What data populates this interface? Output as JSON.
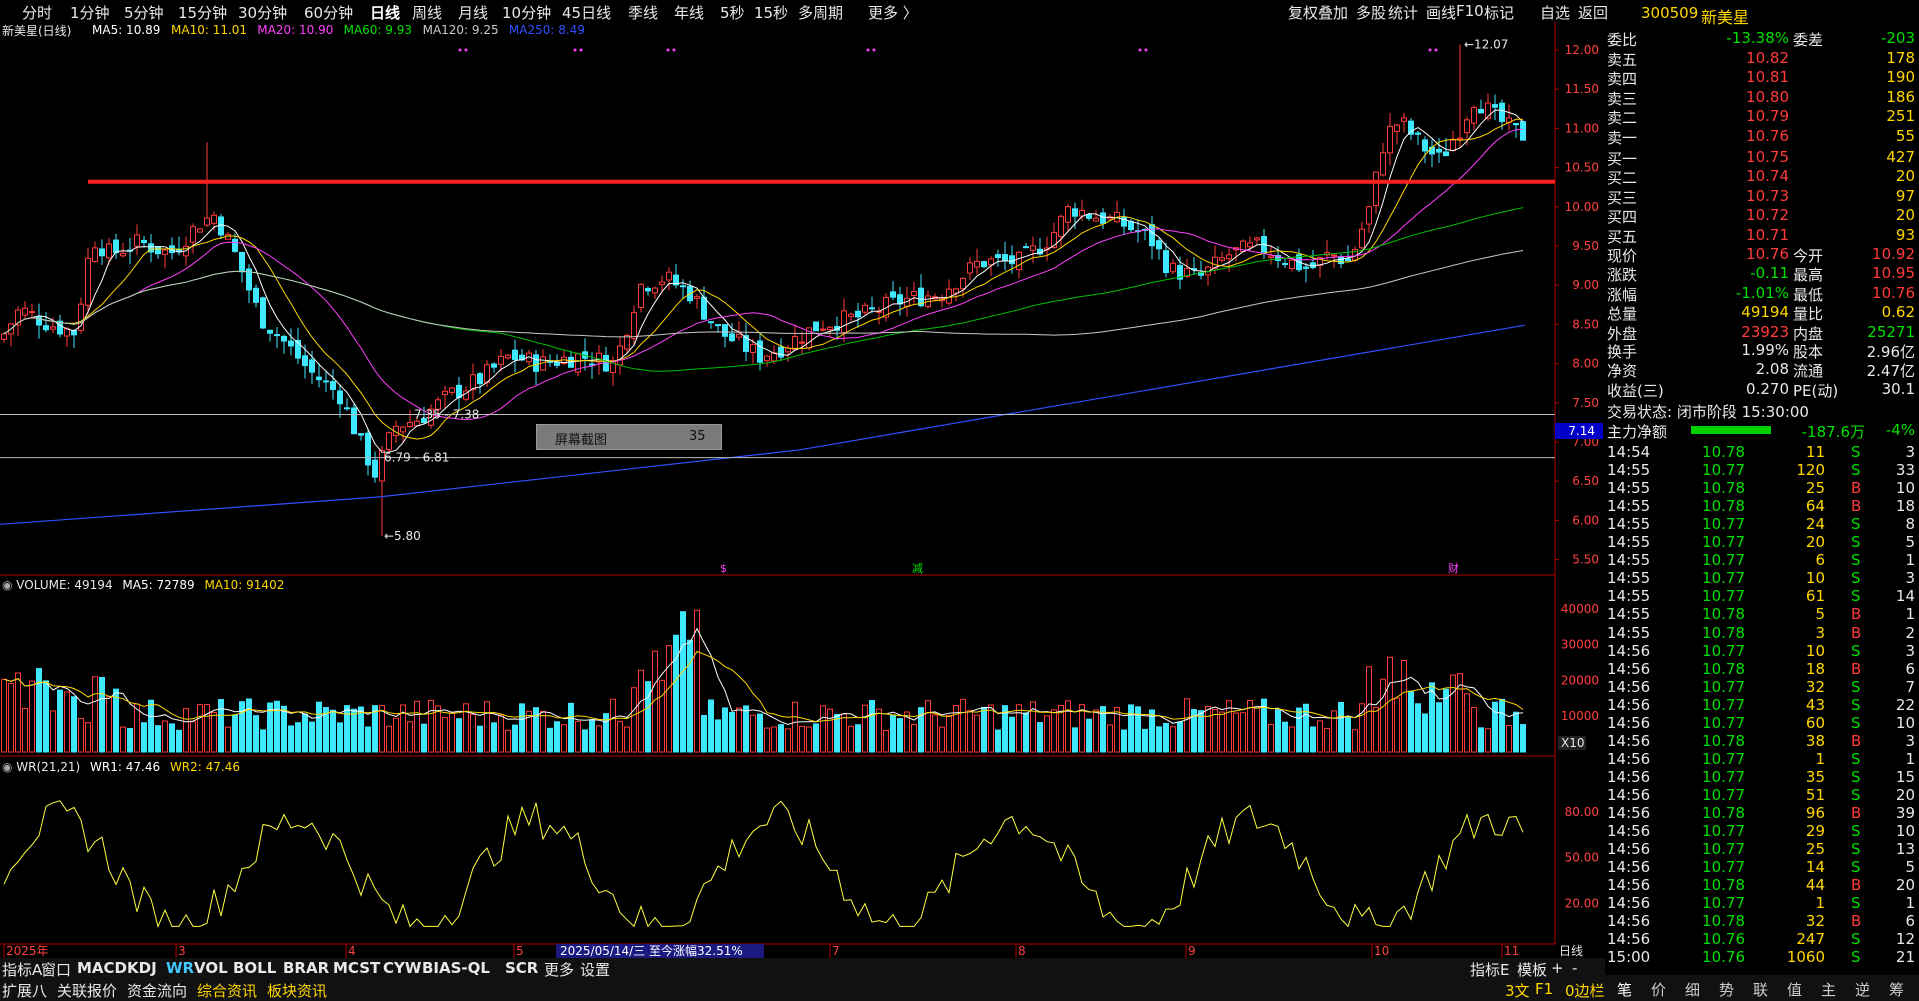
{
  "toolbar": {
    "periods": [
      "分时",
      "1分钟",
      "5分钟",
      "15分钟",
      "30分钟",
      "60分钟",
      "日线",
      "周线",
      "月线",
      "10分钟",
      "45日线",
      "季线",
      "年线",
      "5秒",
      "15秒",
      "多周期",
      "更多 〉"
    ],
    "active_period": "日线",
    "right_items": [
      "复权",
      "叠加",
      "多股",
      "统计",
      "画线",
      "F10",
      "标记",
      "自选",
      "返回"
    ]
  },
  "kline": {
    "title": "新美星(日线)",
    "ma_labels": [
      {
        "text": "MA5: 10.89",
        "color": "#ffffff"
      },
      {
        "text": "MA10: 11.01",
        "color": "#ffd700"
      },
      {
        "text": "MA20: 10.90",
        "color": "#ff40ff"
      },
      {
        "text": "MA60: 9.93",
        "color": "#00e000"
      },
      {
        "text": "MA120: 9.25",
        "color": "#c8c8c8"
      },
      {
        "text": "MA250: 8.49",
        "color": "#3050ff"
      }
    ],
    "y_ticks": [
      "12.00",
      "11.50",
      "11.00",
      "10.50",
      "10.00",
      "9.50",
      "9.00",
      "8.50",
      "8.00",
      "7.50",
      "7.00",
      "6.50",
      "6.00",
      "5.50"
    ],
    "high_label": "12.07",
    "low_label": "5.80",
    "annotation1": "6.79 - 6.81",
    "annotation2": "7.35 - 7.38",
    "current_price_tag": "7.14",
    "screenshot_popup": {
      "label": "屏幕截图",
      "value": "35"
    },
    "markers": [
      "$",
      "减",
      "财"
    ]
  },
  "volume": {
    "title": "VOLUME: 49194",
    "ma5": "MA5: 72789",
    "ma10": "MA10: 91402",
    "y_ticks": [
      "40000",
      "30000",
      "20000",
      "10000"
    ],
    "unit": "X10"
  },
  "wr": {
    "title": "WR(21,21)",
    "wr1": "WR1: 47.46",
    "wr2": "WR2: 47.46",
    "y_ticks": [
      "80.00",
      "50.00",
      "20.00"
    ]
  },
  "xaxis": {
    "labels": [
      "2025年",
      "3",
      "4",
      "5",
      "7",
      "8",
      "9",
      "10",
      "11"
    ],
    "range_text": "2025/05/14/三  至今涨幅32.51%",
    "period_label": "日线"
  },
  "bottom_tabs1": [
    "指标A",
    "窗口",
    "MACD",
    "KDJ",
    "WR",
    "VOL",
    "BOLL",
    "BRAR",
    "MCST",
    "CYW",
    "BIAS-QL",
    "SCR",
    "更多",
    "设置"
  ],
  "bottom_tabs2": [
    "扩展八",
    "关联报价",
    "资金流向",
    "综合资讯",
    "板块资讯"
  ],
  "bottom_right1": [
    "指标E",
    "模板",
    "+",
    "-"
  ],
  "bottom_right2": [
    "3文",
    "F1",
    "0边栏"
  ],
  "quote": {
    "code": "300509",
    "name": "新美星",
    "weibi_label": "委比",
    "weibi": "-13.38%",
    "weicha_label": "委差",
    "weicha": "-203",
    "asks": [
      {
        "label": "卖五",
        "price": "10.82",
        "vol": "178"
      },
      {
        "label": "卖四",
        "price": "10.81",
        "vol": "190"
      },
      {
        "label": "卖三",
        "price": "10.80",
        "vol": "186"
      },
      {
        "label": "卖二",
        "price": "10.79",
        "vol": "251"
      },
      {
        "label": "卖一",
        "price": "10.76",
        "vol": "55"
      }
    ],
    "bids": [
      {
        "label": "买一",
        "price": "10.75",
        "vol": "427"
      },
      {
        "label": "买二",
        "price": "10.74",
        "vol": "20"
      },
      {
        "label": "买三",
        "price": "10.73",
        "vol": "97"
      },
      {
        "label": "买四",
        "price": "10.72",
        "vol": "20"
      },
      {
        "label": "买五",
        "price": "10.71",
        "vol": "93"
      }
    ],
    "stats": [
      {
        "l1": "现价",
        "v1": "10.76",
        "c1": "red",
        "l2": "今开",
        "v2": "10.92",
        "c2": "red"
      },
      {
        "l1": "涨跌",
        "v1": "-0.11",
        "c1": "grn",
        "l2": "最高",
        "v2": "10.95",
        "c2": "red"
      },
      {
        "l1": "涨幅",
        "v1": "-1.01%",
        "c1": "grn",
        "l2": "最低",
        "v2": "10.76",
        "c2": "red"
      },
      {
        "l1": "总量",
        "v1": "49194",
        "c1": "yel",
        "l2": "量比",
        "v2": "0.62",
        "c2": "yel"
      },
      {
        "l1": "外盘",
        "v1": "23923",
        "c1": "red",
        "l2": "内盘",
        "v2": "25271",
        "c2": "grn"
      }
    ],
    "stats2": [
      {
        "l1": "换手",
        "v1": "1.99%",
        "l2": "股本",
        "v2": "2.96亿"
      },
      {
        "l1": "净资",
        "v1": "2.08",
        "l2": "流通",
        "v2": "2.47亿"
      },
      {
        "l1": "收益(三)",
        "v1": "0.270",
        "l2": "PE(动)",
        "v2": "30.1"
      }
    ],
    "trade_status": "交易状态: 闭市阶段 15:30:00",
    "main_flow_label": "主力净额",
    "main_flow_value": "-187.6万",
    "main_flow_pct": "-4%"
  },
  "ticks": [
    {
      "t": "14:54",
      "p": "10.78",
      "v": "11",
      "s": "S",
      "n": "3"
    },
    {
      "t": "14:55",
      "p": "10.77",
      "v": "120",
      "s": "S",
      "n": "33"
    },
    {
      "t": "14:55",
      "p": "10.78",
      "v": "25",
      "s": "B",
      "n": "10"
    },
    {
      "t": "14:55",
      "p": "10.78",
      "v": "64",
      "s": "B",
      "n": "18"
    },
    {
      "t": "14:55",
      "p": "10.77",
      "v": "24",
      "s": "S",
      "n": "8"
    },
    {
      "t": "14:55",
      "p": "10.77",
      "v": "20",
      "s": "S",
      "n": "5"
    },
    {
      "t": "14:55",
      "p": "10.77",
      "v": "6",
      "s": "S",
      "n": "1"
    },
    {
      "t": "14:55",
      "p": "10.77",
      "v": "10",
      "s": "S",
      "n": "3"
    },
    {
      "t": "14:55",
      "p": "10.77",
      "v": "61",
      "s": "S",
      "n": "14"
    },
    {
      "t": "14:55",
      "p": "10.78",
      "v": "5",
      "s": "B",
      "n": "1"
    },
    {
      "t": "14:55",
      "p": "10.78",
      "v": "3",
      "s": "B",
      "n": "2"
    },
    {
      "t": "14:56",
      "p": "10.77",
      "v": "10",
      "s": "S",
      "n": "3"
    },
    {
      "t": "14:56",
      "p": "10.78",
      "v": "18",
      "s": "B",
      "n": "6"
    },
    {
      "t": "14:56",
      "p": "10.77",
      "v": "32",
      "s": "S",
      "n": "7"
    },
    {
      "t": "14:56",
      "p": "10.77",
      "v": "43",
      "s": "S",
      "n": "22"
    },
    {
      "t": "14:56",
      "p": "10.77",
      "v": "60",
      "s": "S",
      "n": "10"
    },
    {
      "t": "14:56",
      "p": "10.78",
      "v": "38",
      "s": "B",
      "n": "3"
    },
    {
      "t": "14:56",
      "p": "10.77",
      "v": "1",
      "s": "S",
      "n": "1"
    },
    {
      "t": "14:56",
      "p": "10.77",
      "v": "35",
      "s": "S",
      "n": "15"
    },
    {
      "t": "14:56",
      "p": "10.77",
      "v": "51",
      "s": "S",
      "n": "20"
    },
    {
      "t": "14:56",
      "p": "10.78",
      "v": "96",
      "s": "B",
      "n": "39"
    },
    {
      "t": "14:56",
      "p": "10.77",
      "v": "29",
      "s": "S",
      "n": "10"
    },
    {
      "t": "14:56",
      "p": "10.77",
      "v": "25",
      "s": "S",
      "n": "13"
    },
    {
      "t": "14:56",
      "p": "10.77",
      "v": "14",
      "s": "S",
      "n": "5"
    },
    {
      "t": "14:56",
      "p": "10.78",
      "v": "44",
      "s": "B",
      "n": "20"
    },
    {
      "t": "14:56",
      "p": "10.77",
      "v": "1",
      "s": "S",
      "n": "1"
    },
    {
      "t": "14:56",
      "p": "10.78",
      "v": "32",
      "s": "B",
      "n": "6"
    },
    {
      "t": "14:56",
      "p": "10.76",
      "v": "247",
      "s": "S",
      "n": "12"
    },
    {
      "t": "15:00",
      "p": "10.76",
      "v": "1060",
      "s": "S",
      "n": "21"
    }
  ],
  "side_tabs": [
    "笔",
    "价",
    "细",
    "势",
    "联",
    "值",
    "主",
    "逆",
    "筹"
  ],
  "colors": {
    "up": "#ff3b3b",
    "down": "#40e8ff",
    "resistance": "#ff2020"
  }
}
